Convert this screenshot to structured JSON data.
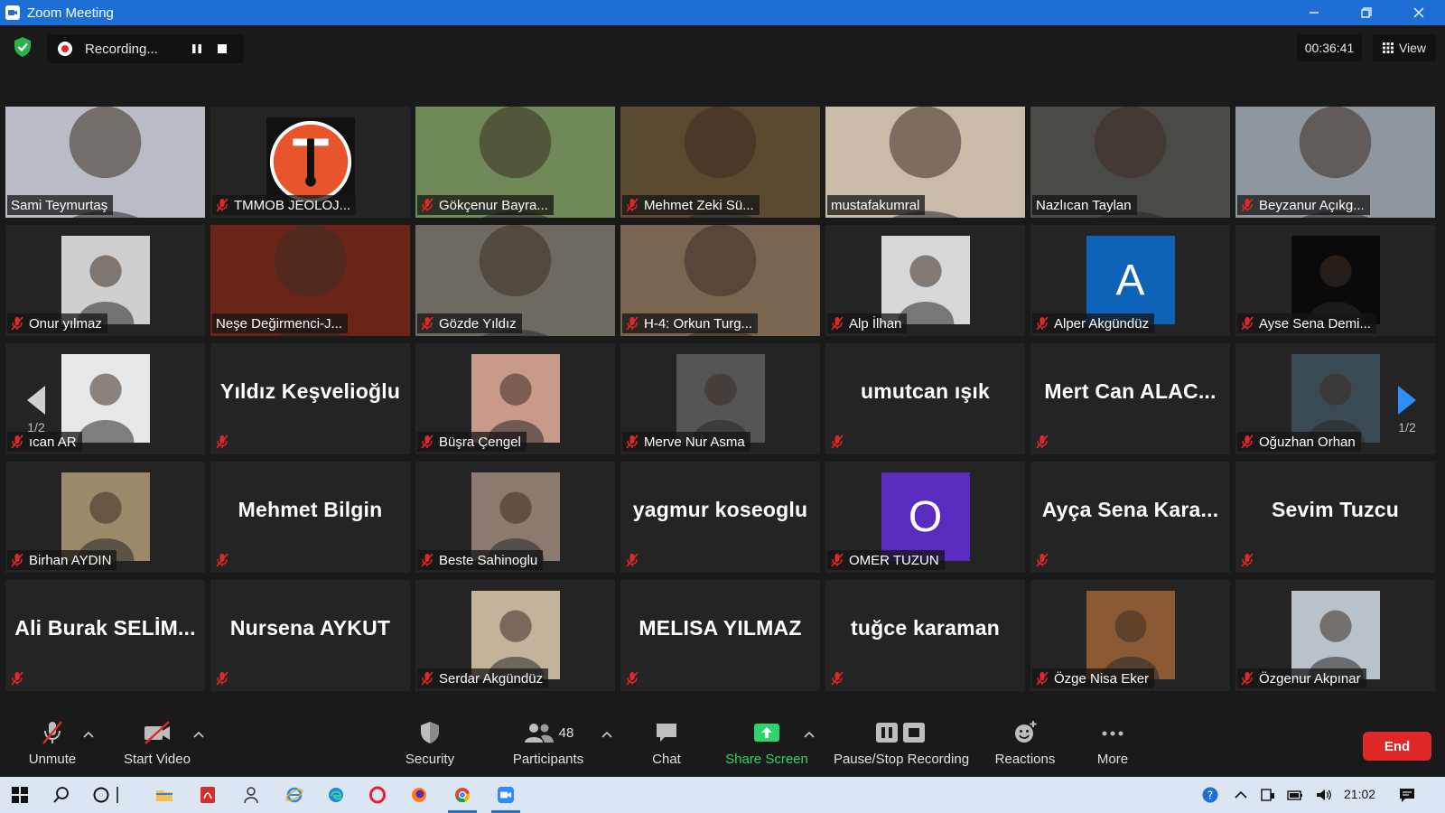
{
  "window": {
    "title": "Zoom Meeting"
  },
  "topbar": {
    "recording_text": "Recording...",
    "timer": "00:36:41",
    "view_label": "View"
  },
  "pagination": {
    "left_page": "1/2",
    "right_page": "1/2"
  },
  "participants": [
    {
      "name": "Sami Teymurtaş",
      "kind": "video",
      "active": true,
      "muted": false,
      "bg": "#b9bcc4"
    },
    {
      "name": "TMMOB JEOLOJ...",
      "kind": "logo",
      "muted": true,
      "bg": "#111111"
    },
    {
      "name": "Gökçenur Bayra...",
      "kind": "video",
      "muted": true,
      "bg": "#6f8a58"
    },
    {
      "name": "Mehmet Zeki Sü...",
      "kind": "video",
      "muted": true,
      "bg": "#5a4a30"
    },
    {
      "name": "mustafakumral",
      "kind": "video",
      "muted": false,
      "bg": "#c8bba8"
    },
    {
      "name": "Nazlıcan Taylan",
      "kind": "video",
      "muted": false,
      "bg": "#4a4a46"
    },
    {
      "name": "Beyzanur Açıkg...",
      "kind": "video",
      "muted": true,
      "bg": "#8f969e"
    },
    {
      "name": "Onur yılmaz",
      "kind": "avatar",
      "muted": true,
      "bg": "#cfcfcf"
    },
    {
      "name": "Neşe Değirmenci-J...",
      "kind": "video",
      "muted": false,
      "bg": "#6b2418"
    },
    {
      "name": "Gözde Yıldız",
      "kind": "video",
      "muted": true,
      "bg": "#6d6a62"
    },
    {
      "name": "H-4: Orkun Turg...",
      "kind": "video",
      "muted": true,
      "bg": "#7a6650"
    },
    {
      "name": "Alp İlhan",
      "kind": "avatar",
      "muted": true,
      "bg": "#d8d8d8"
    },
    {
      "name": "Alper Akgündüz",
      "kind": "letter",
      "letter": "A",
      "muted": true,
      "bg": "#0e62b8"
    },
    {
      "name": "Ayse Sena Demi...",
      "kind": "avatar",
      "muted": true,
      "bg": "#0a0a0a"
    },
    {
      "name": "ıcan AR",
      "kind": "avatar",
      "muted": true,
      "bg": "#e8e8e8"
    },
    {
      "name": "Yıldız Keşvelioğlu",
      "kind": "text",
      "muted": true
    },
    {
      "name": "Büşra Çengel",
      "kind": "avatar",
      "muted": true,
      "bg": "#c79a8a"
    },
    {
      "name": "Merve Nur Asma",
      "kind": "avatar",
      "muted": true,
      "bg": "#555555"
    },
    {
      "name": "umutcan ışık",
      "kind": "text",
      "muted": true
    },
    {
      "name": "Mert Can ALAC...",
      "kind": "text",
      "muted": true
    },
    {
      "name": "Oğuzhan Orhan",
      "kind": "avatar",
      "muted": true,
      "bg": "#3a4a52"
    },
    {
      "name": "Birhan AYDIN",
      "kind": "avatar",
      "muted": true,
      "bg": "#9a8a6a"
    },
    {
      "name": "Mehmet Bilgin",
      "kind": "text",
      "muted": true
    },
    {
      "name": "Beste Sahinoglu",
      "kind": "avatar",
      "muted": true,
      "bg": "#8a7a70"
    },
    {
      "name": "yagmur koseoglu",
      "kind": "text",
      "muted": true
    },
    {
      "name": "OMER TUZUN",
      "kind": "letter",
      "letter": "O",
      "muted": true,
      "bg": "#5a2bbf"
    },
    {
      "name": "Ayça Sena Kara...",
      "kind": "text",
      "muted": true
    },
    {
      "name": "Sevim Tuzcu",
      "kind": "text",
      "muted": true
    },
    {
      "name": "Ali Burak SELİM...",
      "kind": "text",
      "muted": true
    },
    {
      "name": "Nursena AYKUT",
      "kind": "text",
      "muted": true
    },
    {
      "name": "Serdar Akgündüz",
      "kind": "avatar",
      "muted": true,
      "bg": "#c2b39a"
    },
    {
      "name": "MELISA YILMAZ",
      "kind": "text",
      "muted": true
    },
    {
      "name": "tuğce karaman",
      "kind": "text",
      "muted": true
    },
    {
      "name": "Özge Nisa Eker",
      "kind": "avatar",
      "muted": true,
      "bg": "#8a5a34"
    },
    {
      "name": "Özgenur Akpınar",
      "kind": "avatar",
      "muted": true,
      "bg": "#b8c2c8"
    }
  ],
  "toolbar": {
    "unmute": "Unmute",
    "start_video": "Start Video",
    "security": "Security",
    "participants": "Participants",
    "participants_count": "48",
    "chat": "Chat",
    "share_screen": "Share Screen",
    "pause_stop": "Pause/Stop Recording",
    "reactions": "Reactions",
    "more": "More",
    "end": "End"
  },
  "taskbar": {
    "clock": "21:02"
  },
  "colors": {
    "zoom_blue": "#1d6fd6",
    "share_green": "#2ad66a",
    "end_red": "#e02828",
    "active_border": "#ecec6a"
  }
}
